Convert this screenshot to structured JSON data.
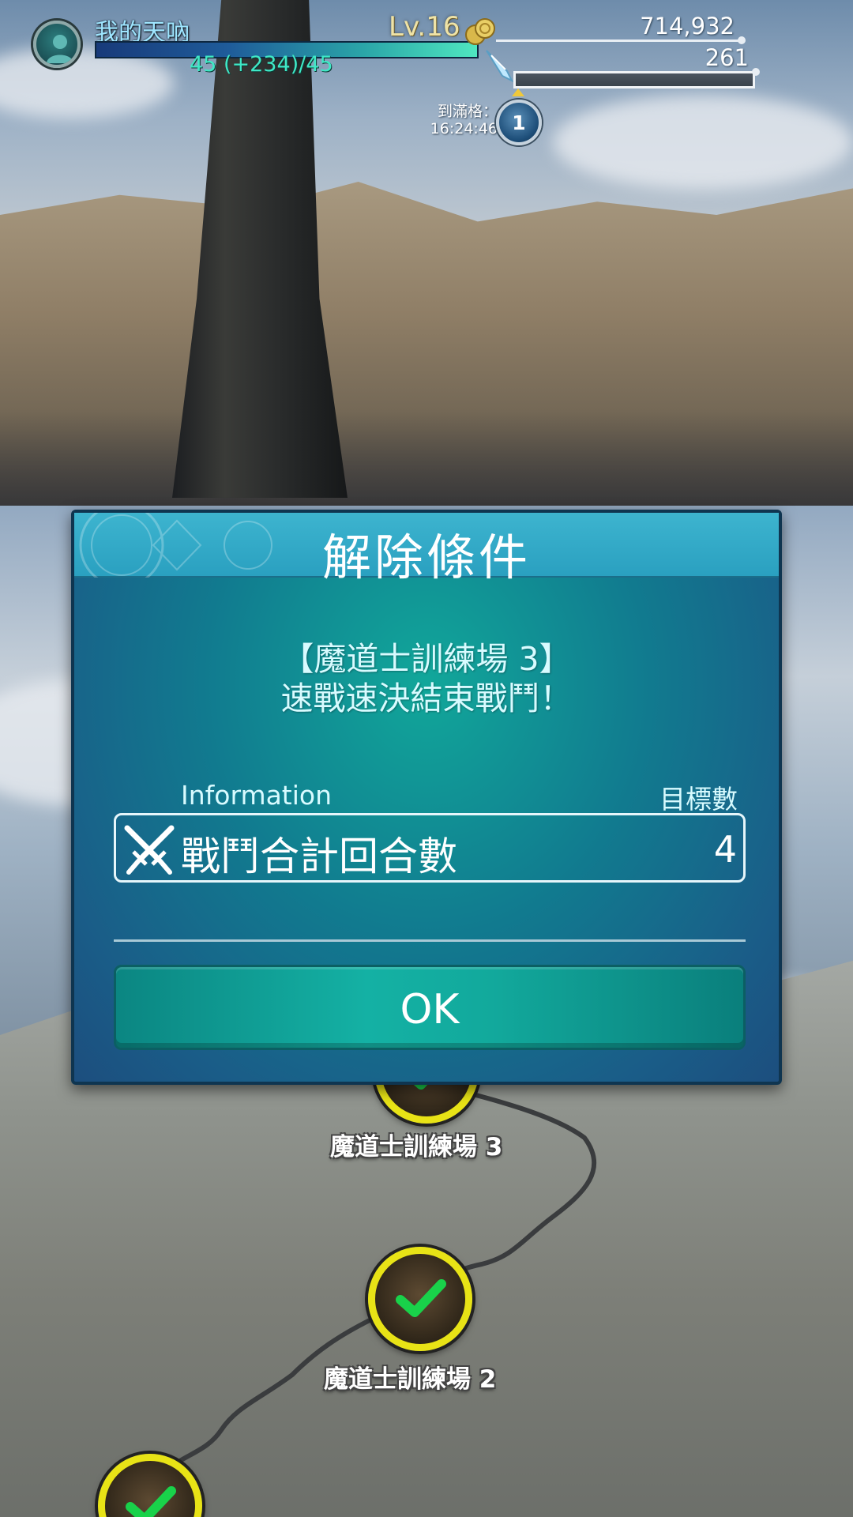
{
  "hud": {
    "player_name": "我的天吶",
    "level": "Lv.16",
    "exp_text": "45 (+234)/45",
    "gold": "714,932",
    "stamina": "261",
    "refill_label_1": "到滿格：",
    "refill_label_2": "16:24:46",
    "refill_count": "1"
  },
  "dialog": {
    "title": "解除條件",
    "message_line1": "【魔道士訓練場 3】",
    "message_line2": "速戰速決結束戰鬥！",
    "info_label": "Information",
    "target_label": "目標數",
    "condition_text": "戰鬥合計回合數",
    "condition_value": "4",
    "ok_label": "OK"
  },
  "map": {
    "nodes": [
      {
        "label": "魔道士訓練場 3",
        "cleared": true
      },
      {
        "label": "魔道士訓練場 2",
        "cleared": true
      },
      {
        "label": "",
        "cleared": true
      }
    ]
  },
  "colors": {
    "accent": "#2aa0c0",
    "button": "#14b1a4",
    "node_ring": "#e8e316",
    "check": "#19d24a"
  }
}
